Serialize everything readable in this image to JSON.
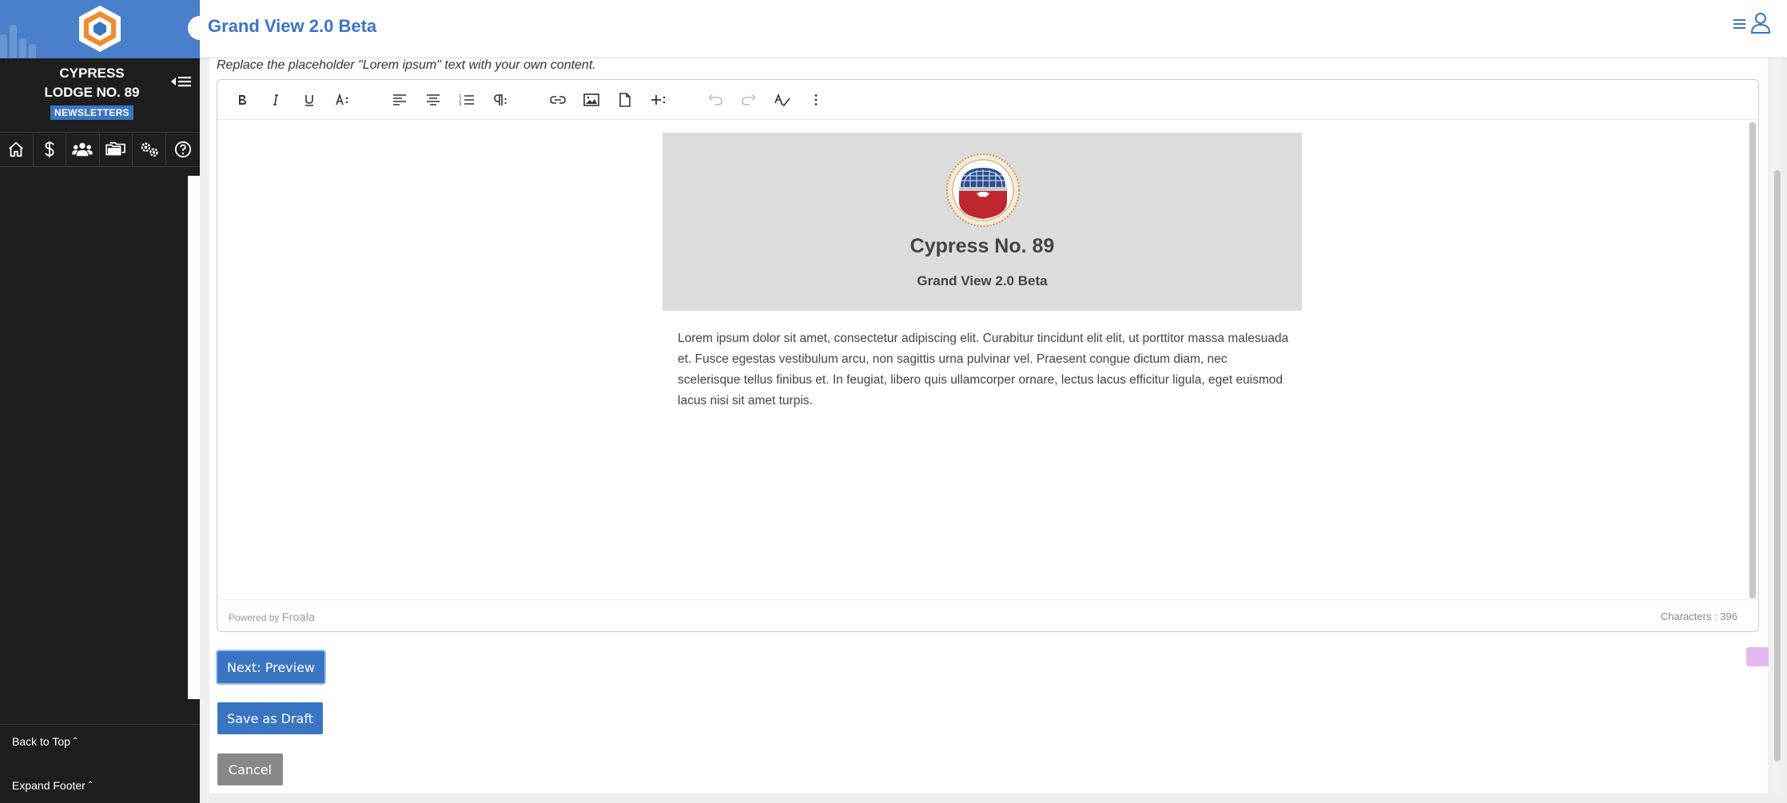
{
  "app": {
    "title": "Grand View 2.0 Beta"
  },
  "sidebar": {
    "lodge_name_line1": "CYPRESS",
    "lodge_name_line2": "LODGE NO. 89",
    "badge": "NEWSLETTERS",
    "nav_icons": [
      "home-icon",
      "dollar-icon",
      "members-icon",
      "folders-icon",
      "settings-gears-icon",
      "help-icon"
    ],
    "back_to_top": "Back to Top",
    "expand_footer": "Expand Footer"
  },
  "content": {
    "hint": "Replace the placeholder \"Lorem ipsum\" text with your own content."
  },
  "editor": {
    "toolbar": [
      "bold",
      "italic",
      "underline",
      "font-size",
      "align-left",
      "align-center",
      "ordered-list",
      "paragraph-format",
      "insert-link",
      "insert-image",
      "insert-file",
      "more-insert",
      "undo",
      "redo",
      "spell-check",
      "more"
    ],
    "powered_by": "Powered by",
    "powered_brand": "Froala",
    "char_count": "Characters : 396"
  },
  "newsletter": {
    "title": "Cypress No. 89",
    "subtitle": "Grand View 2.0 Beta",
    "body": "Lorem ipsum dolor sit amet, consectetur adipiscing elit. Curabitur tincidunt elit elit, ut porttitor massa malesuada et. Fusce egestas vestibulum arcu, non sagittis urna pulvinar vel. Praesent congue dictum diam, nec scelerisque tellus finibus et. In feugiat, libero quis ullamcorper ornare, lectus lacus efficitur ligula, eget euismod lacus nisi sit amet turpis."
  },
  "buttons": {
    "next_preview": "Next: Preview",
    "save_draft": "Save as Draft",
    "cancel": "Cancel"
  },
  "colors": {
    "accent": "#3a75c4",
    "sidebar_bg": "#1e1e1e",
    "logo_bg": "#4a7fcb",
    "newsletter_header_bg": "#dcdcdc"
  }
}
